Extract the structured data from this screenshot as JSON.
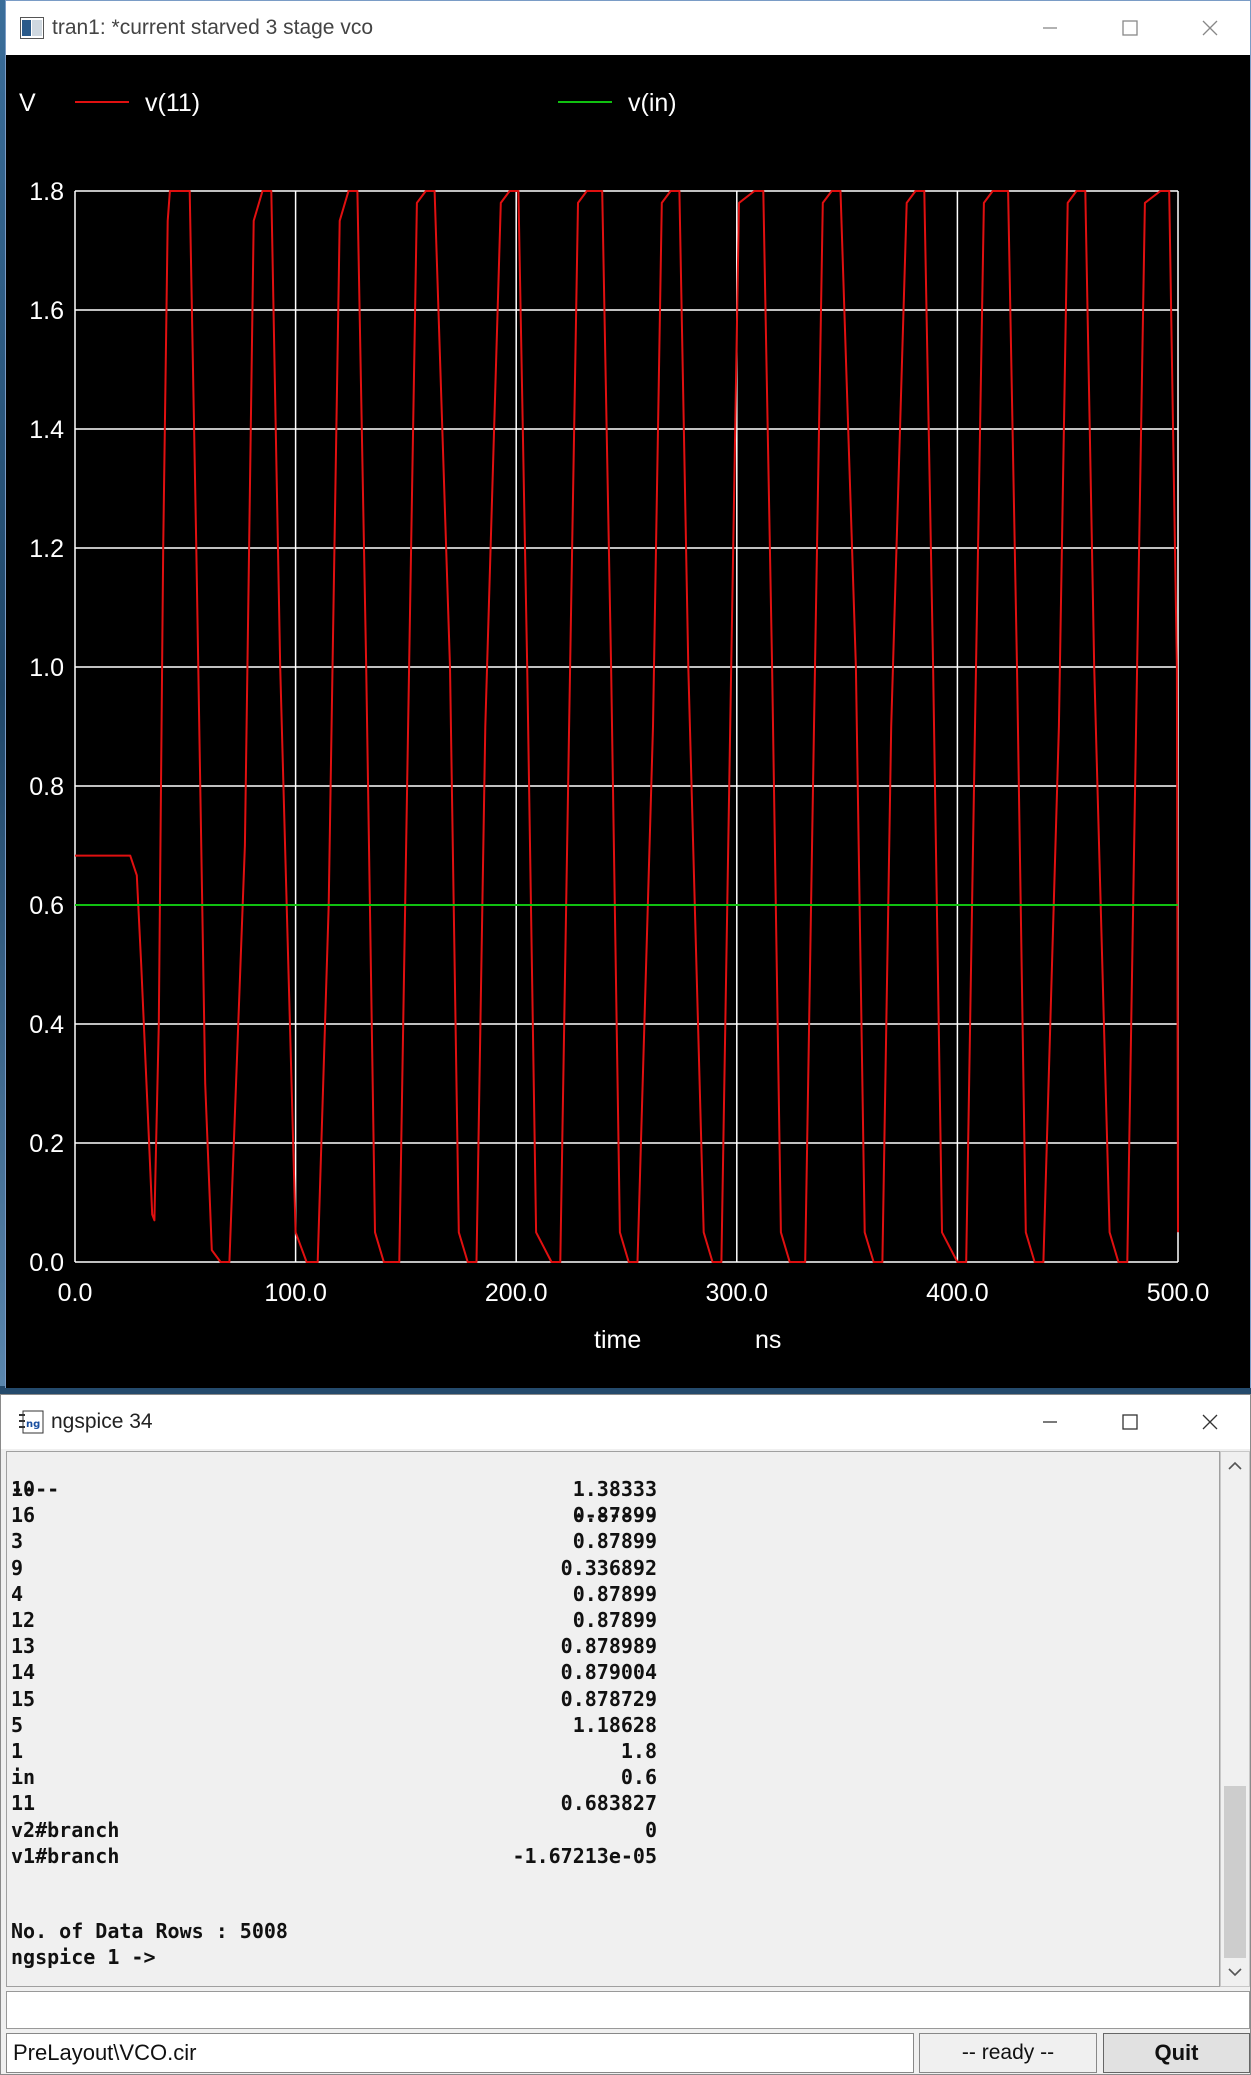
{
  "plot_window": {
    "title": "tran1: *current starved 3 stage vco",
    "legend_unit": "V"
  },
  "chart_data": {
    "type": "line",
    "xlabel": "time",
    "xunit": "ns",
    "xlim": [
      0,
      500
    ],
    "ylim": [
      0,
      1.8
    ],
    "x_ticks": [
      "0.0",
      "100.0",
      "200.0",
      "300.0",
      "400.0",
      "500.0"
    ],
    "y_ticks": [
      "0.0",
      "0.2",
      "0.4",
      "0.6",
      "0.8",
      "1.0",
      "1.2",
      "1.4",
      "1.6",
      "1.8"
    ],
    "grid": true,
    "background": "#000000",
    "grid_color": "#ffffff",
    "series": [
      {
        "name": "v(11)",
        "color": "#e01010",
        "x": [
          0,
          5,
          10,
          15,
          20,
          25,
          28,
          30,
          33,
          35,
          36,
          38,
          40,
          42,
          43,
          47,
          52,
          55,
          59,
          62,
          66,
          70,
          77,
          81,
          85,
          89,
          93,
          100,
          105,
          110,
          115,
          120,
          124,
          128,
          132,
          136,
          140,
          147,
          151,
          155,
          159,
          163,
          170,
          174,
          178,
          182,
          186,
          193,
          197,
          201,
          205,
          209,
          216,
          220,
          224,
          228,
          232,
          239,
          243,
          247,
          251,
          255,
          262,
          266,
          270,
          274,
          278,
          285,
          289,
          293,
          297,
          301,
          308,
          312,
          316,
          320,
          324,
          331,
          335,
          339,
          343,
          347,
          354,
          358,
          362,
          366,
          370,
          377,
          381,
          385,
          389,
          393,
          400,
          404,
          408,
          412,
          416,
          423,
          427,
          431,
          435,
          439,
          446,
          450,
          454,
          458,
          462,
          469,
          473,
          477,
          481,
          485,
          492,
          496,
          499.5,
          500
        ],
        "y": [
          0.683,
          0.683,
          0.683,
          0.683,
          0.683,
          0.683,
          0.65,
          0.5,
          0.25,
          0.08,
          0.07,
          0.4,
          1.2,
          1.75,
          1.8,
          1.8,
          1.8,
          1.2,
          0.3,
          0.02,
          0.0,
          0.0,
          0.7,
          1.75,
          1.8,
          1.8,
          1.0,
          0.05,
          0.0,
          0.0,
          0.6,
          1.75,
          1.8,
          1.8,
          1.0,
          0.05,
          0.0,
          0.0,
          0.9,
          1.78,
          1.8,
          1.8,
          1.0,
          0.05,
          0.0,
          0.0,
          0.9,
          1.78,
          1.8,
          1.8,
          1.0,
          0.05,
          0.0,
          0.0,
          0.9,
          1.78,
          1.8,
          1.8,
          1.0,
          0.05,
          0.0,
          0.0,
          0.9,
          1.78,
          1.8,
          1.8,
          1.0,
          0.05,
          0.0,
          0.0,
          0.9,
          1.78,
          1.8,
          1.8,
          1.0,
          0.05,
          0.0,
          0.0,
          0.9,
          1.78,
          1.8,
          1.8,
          1.0,
          0.05,
          0.0,
          0.0,
          0.9,
          1.78,
          1.8,
          1.8,
          1.0,
          0.05,
          0.0,
          0.0,
          0.9,
          1.78,
          1.8,
          1.8,
          1.0,
          0.05,
          0.0,
          0.0,
          0.9,
          1.78,
          1.8,
          1.8,
          1.0,
          0.05,
          0.0,
          0.0,
          0.9,
          1.78,
          1.8,
          1.8,
          1.0,
          0.05
        ]
      },
      {
        "name": "v(in)",
        "color": "#10c010",
        "x": [
          0,
          500
        ],
        "y": [
          0.6,
          0.6
        ]
      }
    ]
  },
  "console_window": {
    "title": "ngspice 34",
    "header_left": "----",
    "header_right": "-------",
    "rows": [
      {
        "node": "10",
        "value": "1.38333"
      },
      {
        "node": "16",
        "value": "0.87899"
      },
      {
        "node": "3",
        "value": "0.87899"
      },
      {
        "node": "9",
        "value": "0.336892"
      },
      {
        "node": "4",
        "value": "0.87899"
      },
      {
        "node": "12",
        "value": "0.87899"
      },
      {
        "node": "13",
        "value": "0.878989"
      },
      {
        "node": "14",
        "value": "0.879004"
      },
      {
        "node": "15",
        "value": "0.878729"
      },
      {
        "node": "5",
        "value": "1.18628"
      },
      {
        "node": "1",
        "value": "1.8"
      },
      {
        "node": "in",
        "value": "0.6"
      },
      {
        "node": "11",
        "value": "0.683827"
      },
      {
        "node": "v2#branch",
        "value": "0"
      },
      {
        "node": "v1#branch",
        "value": "-1.67213e-05"
      }
    ],
    "data_rows_line": "No. of Data Rows : 5008",
    "prompt": "ngspice 1 ->",
    "input_value": "",
    "status_file": "PreLayout\\VCO.cir",
    "status": "-- ready --",
    "quit_label": "Quit"
  }
}
